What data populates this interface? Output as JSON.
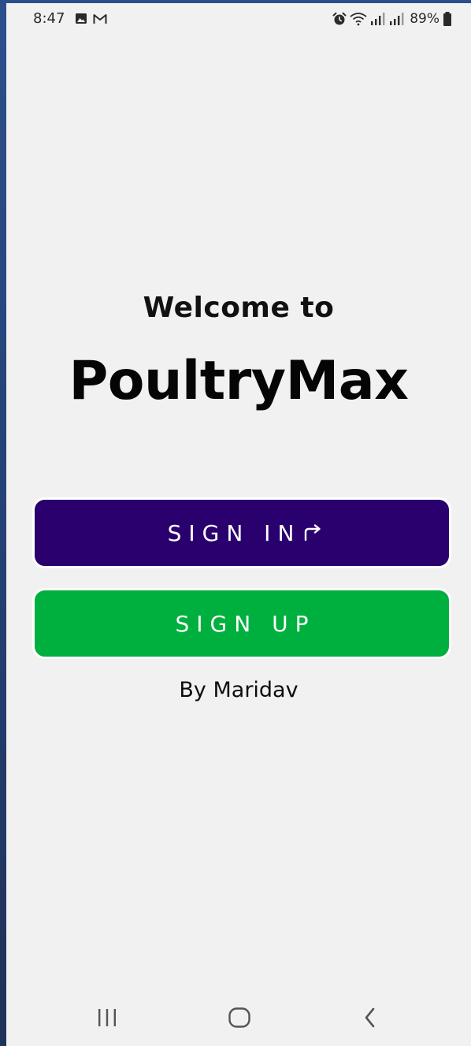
{
  "status_bar": {
    "time": "8:47",
    "battery": "89%",
    "icons": [
      "photo-icon",
      "gmail-icon",
      "alarm-icon",
      "wifi-icon",
      "signal-icon",
      "signal-icon",
      "battery-icon"
    ]
  },
  "welcome": {
    "line1": "Welcome to",
    "app_name": "PoultryMax"
  },
  "buttons": {
    "sign_in": "SIGN IN",
    "sign_up": "SIGN UP"
  },
  "byline": "By Maridav",
  "colors": {
    "sign_in_bg": "#2a006e",
    "sign_up_bg": "#00b03e",
    "screen_bg": "#f1f1f1"
  },
  "nav": {
    "icons": [
      "recents-icon",
      "home-icon",
      "back-icon"
    ]
  }
}
